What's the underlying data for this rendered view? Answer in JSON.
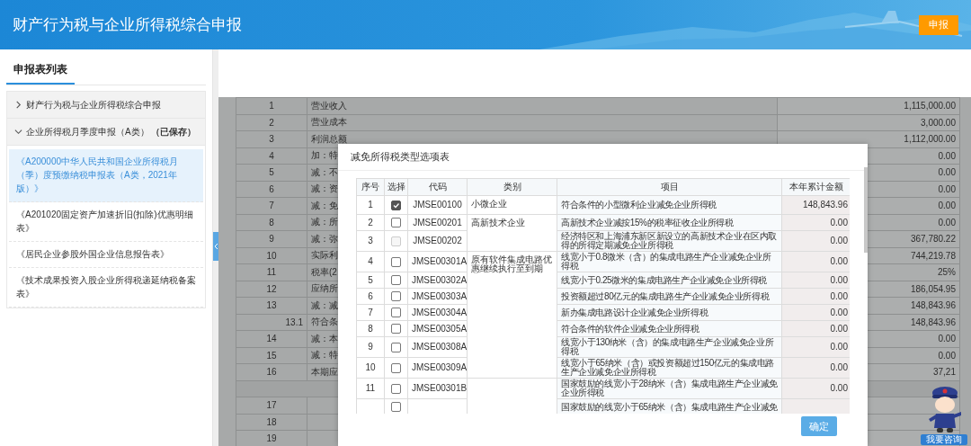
{
  "header": {
    "title": "财产行为税与企业所得税综合申报",
    "action_button": "申报"
  },
  "sidebar": {
    "title": "申报表列表",
    "groups": [
      {
        "label": "财产行为税与企业所得税综合申报",
        "expanded": false
      },
      {
        "label": "企业所得税月季度申报（A类） **（已保存）**",
        "expanded": true,
        "children": [
          {
            "label": "《A200000中华人民共和国企业所得税月（季）度预缴纳税申报表（A类，2021年版）》",
            "selected": true
          },
          {
            "label": "《A201020固定资产加速折旧(扣除)优惠明细表》",
            "selected": false
          },
          {
            "label": "《居民企业参股外国企业信息报告表》",
            "selected": false
          },
          {
            "label": "《技术成果投资入股企业所得税递延纳税备案表》",
            "selected": false
          }
        ]
      }
    ]
  },
  "background_table": {
    "rows": [
      {
        "kind": "main",
        "line": "1",
        "item": "营业收入",
        "amount": "1,115,000.00"
      },
      {
        "kind": "main",
        "line": "2",
        "item": "营业成本",
        "amount": "3,000.00"
      },
      {
        "kind": "main",
        "line": "3",
        "item": "利润总额",
        "amount": "1,112,000.00"
      },
      {
        "kind": "main",
        "line": "4",
        "item": "加：特",
        "amount": "0.00"
      },
      {
        "kind": "main",
        "line": "5",
        "item": "减：不",
        "amount": "0.00"
      },
      {
        "kind": "main",
        "line": "6",
        "item": "减：资",
        "amount": "0.00"
      },
      {
        "kind": "main",
        "line": "7",
        "item": "减：免",
        "amount": "0.00"
      },
      {
        "kind": "main",
        "line": "8",
        "item": "减：所",
        "amount": "0.00"
      },
      {
        "kind": "main",
        "line": "9",
        "item": "减：弥",
        "amount": "367,780.22"
      },
      {
        "kind": "main",
        "line": "10",
        "item": "实际利",
        "amount": "744,219.78"
      },
      {
        "kind": "main",
        "line": "11",
        "item": "税率(2",
        "amount": "25%"
      },
      {
        "kind": "main",
        "line": "12",
        "item": "应纳所",
        "amount": "186,054.95"
      },
      {
        "kind": "main",
        "line": "13",
        "item": "减：减",
        "amount": "148,843.96"
      },
      {
        "kind": "sub",
        "line": "13.1",
        "item": "符合条",
        "amount": "148,843.96"
      },
      {
        "kind": "main",
        "line": "14",
        "item": "减：本",
        "amount": "0.00"
      },
      {
        "kind": "main",
        "line": "15",
        "item": "减：特",
        "amount": "0.00"
      },
      {
        "kind": "main",
        "line": "16",
        "item": "本期应",
        "amount": "37,21"
      },
      {
        "kind": "blank"
      },
      {
        "kind": "main",
        "line": "17"
      },
      {
        "kind": "main",
        "line": "18"
      },
      {
        "kind": "main",
        "line": "19"
      }
    ]
  },
  "modal": {
    "title": "减免所得税类型选项表",
    "columns": [
      "序号",
      "选择",
      "代码",
      "类别",
      "项目",
      "本年累计金额"
    ],
    "groups": [
      {
        "category": "小微企业",
        "rows": [
          {
            "no": "1",
            "checked": true,
            "disabled": false,
            "code": "JMSE00100",
            "item": "符合条件的小型微利企业减免企业所得税",
            "amount": "148,843.96"
          }
        ]
      },
      {
        "category": "高新技术企业",
        "rows": [
          {
            "no": "2",
            "checked": false,
            "disabled": false,
            "code": "JMSE00201",
            "item": "高新技术企业减按15%的税率征收企业所得税",
            "amount": "0.00"
          },
          {
            "no": "3",
            "checked": false,
            "disabled": true,
            "code": "JMSE00202",
            "item": "经济特区和上海浦东新区新设立的高新技术企业在区内取得的所得定期减免企业所得税",
            "amount": "0.00"
          }
        ]
      },
      {
        "category": "原有软件集成电路优惠继续执行至到期",
        "rows": [
          {
            "no": "4",
            "checked": false,
            "disabled": false,
            "code": "JMSE00301A",
            "item": "线宽小于0.8微米（含）的集成电路生产企业减免企业所得税",
            "amount": "0.00"
          },
          {
            "no": "5",
            "checked": false,
            "disabled": false,
            "code": "JMSE00302A",
            "item": "线宽小于0.25微米的集成电路生产企业减免企业所得税",
            "amount": "0.00"
          },
          {
            "no": "6",
            "checked": false,
            "disabled": false,
            "code": "JMSE00303A",
            "item": "投资额超过80亿元的集成电路生产企业减免企业所得税",
            "amount": "0.00"
          },
          {
            "no": "7",
            "checked": false,
            "disabled": false,
            "code": "JMSE00304A",
            "item": "新办集成电路设计企业减免企业所得税",
            "amount": "0.00"
          },
          {
            "no": "8",
            "checked": false,
            "disabled": false,
            "code": "JMSE00305A",
            "item": "符合条件的软件企业减免企业所得税",
            "amount": "0.00"
          },
          {
            "no": "9",
            "checked": false,
            "disabled": false,
            "code": "JMSE00308A",
            "item": "线宽小于130纳米（含）的集成电路生产企业减免企业所得税",
            "amount": "0.00"
          },
          {
            "no": "10",
            "checked": false,
            "disabled": false,
            "code": "JMSE00309A",
            "item": "线宽小于65纳米（含）或投资额超过150亿元的集成电路生产企业减免企业所得税",
            "amount": "0.00"
          }
        ]
      },
      {
        "rows": [
          {
            "no": "11",
            "checked": false,
            "disabled": false,
            "code": "JMSE00301B",
            "item": "国家鼓励的线宽小于28纳米（含）集成电路生产企业减免企业所得税",
            "amount": "0.00"
          },
          {
            "checked": false,
            "disabled": false,
            "item": "国家鼓励的线宽小于65纳米（含）集成电路生产企业减免"
          }
        ]
      }
    ],
    "confirm_button": "确定"
  },
  "assistant": {
    "label": "我要咨询"
  }
}
